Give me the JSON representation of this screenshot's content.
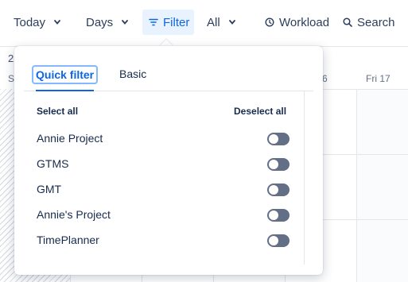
{
  "toolbar": {
    "today_label": "Today",
    "days_label": "Days",
    "filter_label": "Filter",
    "all_label": "All",
    "workload_label": "Workload",
    "search_label": "Search"
  },
  "calendar": {
    "header_fragment": "2",
    "subheader_fragment": "S",
    "day_fragment": "6",
    "friday_label": "Fri 17"
  },
  "filter_popup": {
    "tabs": [
      {
        "label": "Quick filter",
        "active": true
      },
      {
        "label": "Basic",
        "active": false
      }
    ],
    "select_all_label": "Select all",
    "deselect_all_label": "Deselect all",
    "projects": [
      {
        "name": "Annie Project",
        "enabled": false
      },
      {
        "name": "GTMS",
        "enabled": false
      },
      {
        "name": "GMT",
        "enabled": false
      },
      {
        "name": "Annie's Project",
        "enabled": false
      },
      {
        "name": "TimePlanner",
        "enabled": false
      }
    ]
  },
  "icons": {
    "filter": "filter-icon",
    "workload": "clock-icon",
    "search": "search-icon",
    "dropdown": "chevron-down-icon"
  },
  "colors": {
    "accent": "#0c66e4",
    "filter_bg": "#e9f2ff",
    "toggle_off": "#626f86",
    "text": "#172b4d"
  }
}
